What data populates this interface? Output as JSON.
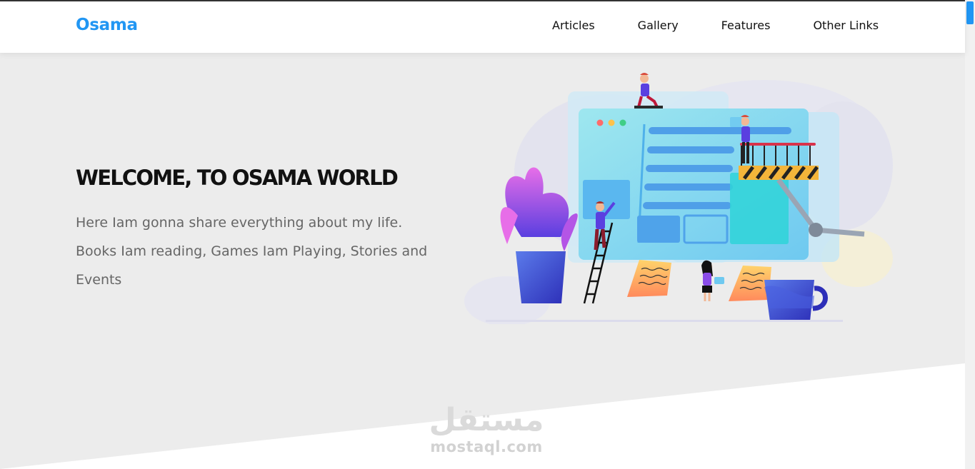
{
  "header": {
    "logo": "Osama",
    "nav": [
      "Articles",
      "Gallery",
      "Features",
      "Other Links"
    ]
  },
  "hero": {
    "title": "WELCOME, TO OSAMA WORLD",
    "description": "Here Iam gonna share everything about my life. Books Iam reading, Games Iam Playing, Stories and Events"
  },
  "watermark": {
    "arabic": "مستقل",
    "latin": "mostaql.com"
  },
  "colors": {
    "accent": "#2196f3",
    "landing_bg": "#ececec",
    "text_dark": "#111111",
    "text_muted": "#666666"
  }
}
